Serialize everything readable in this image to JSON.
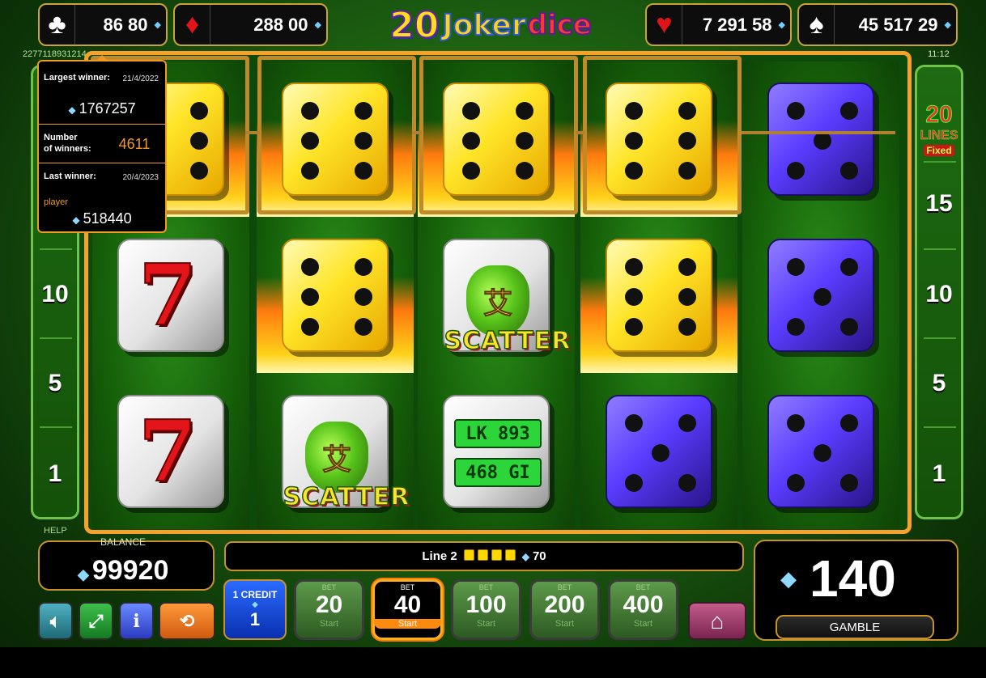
{
  "jackpots": [
    {
      "suit": "clubs-icon",
      "glyph": "♣",
      "value": "86 80",
      "color": "#ffffff"
    },
    {
      "suit": "diamonds-icon",
      "glyph": "♦",
      "value": "288 00",
      "color": "#e0141a"
    },
    {
      "suit": "hearts-icon",
      "glyph": "♥",
      "value": "7 291 58",
      "color": "#e0141a"
    },
    {
      "suit": "spades-icon",
      "glyph": "♠",
      "value": "45 517 29",
      "color": "#ffffff"
    }
  ],
  "logo": {
    "number": "20",
    "word": "Joker",
    "suffix": "dice"
  },
  "session_id": "2277118931214",
  "clock": "11:12",
  "lines": {
    "count": "20",
    "label": "LINES",
    "fixed": "Fixed",
    "left_markers": [
      "10",
      "5",
      "1"
    ],
    "right_markers": [
      "15",
      "10",
      "5",
      "1"
    ]
  },
  "popup": {
    "largest_label": "Largest winner:",
    "largest_date": "21/4/2022",
    "largest_value": "1767257",
    "count_label_1": "Number",
    "count_label_2": "of winners:",
    "count_value": "4611",
    "last_label": "Last winner:",
    "last_date": "20/4/2023",
    "last_name": "player",
    "last_value": "518440"
  },
  "reels": [
    [
      "yellow-6",
      "seven",
      "seven"
    ],
    [
      "yellow-6",
      "yellow-6",
      "scatter"
    ],
    [
      "yellow-6",
      "scatter",
      "plate"
    ],
    [
      "yellow-6",
      "yellow-6",
      "blue-5"
    ],
    [
      "blue-5",
      "blue-5",
      "blue-5"
    ]
  ],
  "scatter_text": "SCATTER",
  "plate_top": "LK 893",
  "plate_bottom": "468 GI",
  "bag_glyph": "艾",
  "help": "HELP",
  "balance": {
    "label": "BALANCE",
    "value": "99920"
  },
  "status": {
    "line": "Line 2",
    "win": "70"
  },
  "win": {
    "value": "140",
    "gamble": "GAMBLE"
  },
  "credit": {
    "label": "1 CREDIT",
    "value": "1"
  },
  "bets": [
    {
      "top": "BET",
      "value": "20",
      "start": "Start",
      "active": false
    },
    {
      "top": "BET",
      "value": "40",
      "start": "Start",
      "active": true
    },
    {
      "top": "BET",
      "value": "100",
      "start": "Start",
      "active": false
    },
    {
      "top": "BET",
      "value": "200",
      "start": "Start",
      "active": false
    },
    {
      "top": "BET",
      "value": "400",
      "start": "Start",
      "active": false
    }
  ],
  "controls": [
    {
      "name": "sound-icon",
      "glyph": "◀)",
      "color": "#3a8fa0"
    },
    {
      "name": "fullscreen-icon",
      "glyph": "⤢",
      "color": "#2a9a3a"
    },
    {
      "name": "info-icon",
      "glyph": "i",
      "color": "#4a6aff"
    },
    {
      "name": "autoplay-icon",
      "glyph": "⟲",
      "color": "#f07a20"
    }
  ],
  "home_glyph": "⌂"
}
